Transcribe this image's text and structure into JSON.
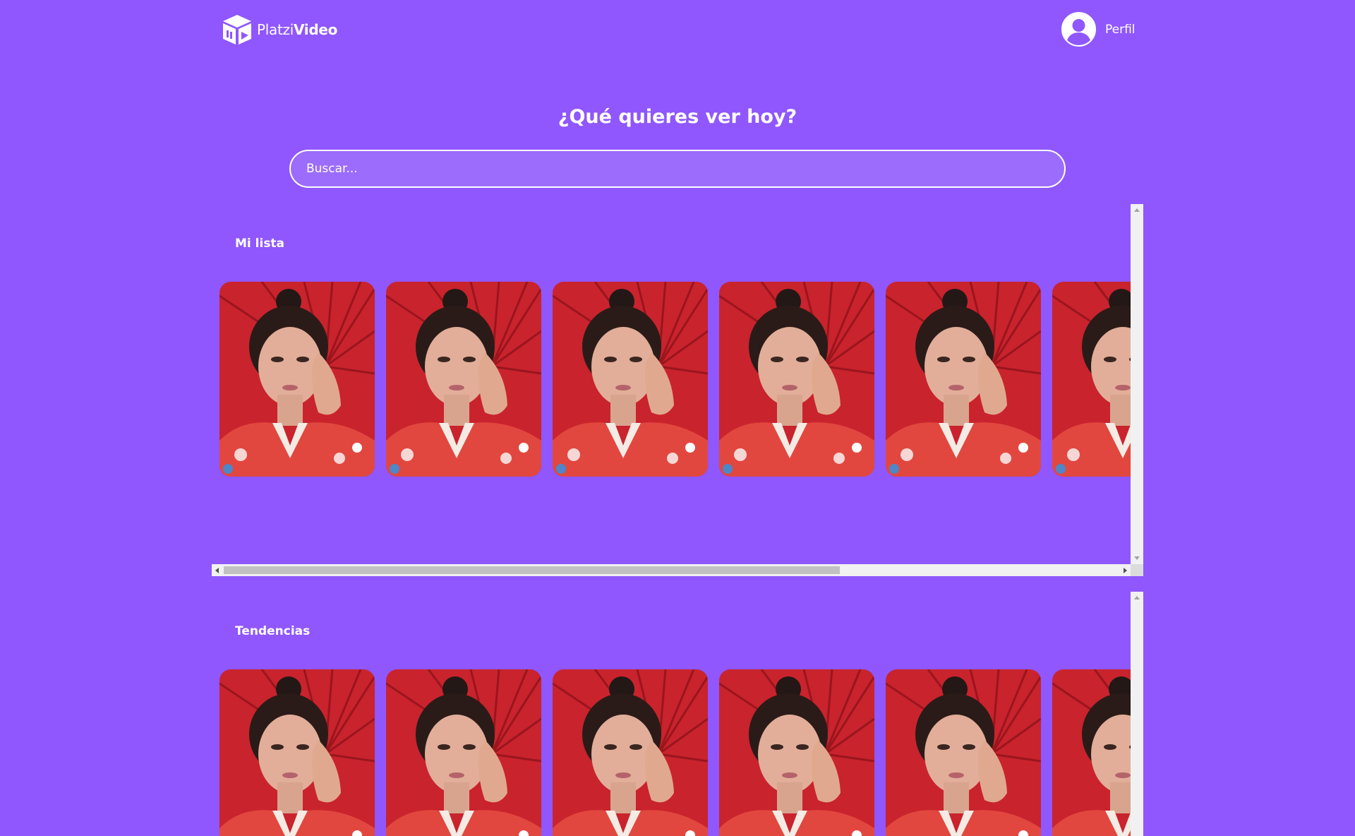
{
  "header": {
    "logo": {
      "name_regular": "Platzi",
      "name_bold": "Video",
      "icon": "cube-play-icon"
    },
    "profile": {
      "label": "Perfil",
      "icon": "user-avatar-icon"
    }
  },
  "search": {
    "title": "¿Qué quieres ver hoy?",
    "placeholder": "Buscar..."
  },
  "categories": [
    {
      "title": "Mi lista",
      "thumbnails": 6
    },
    {
      "title": "Tendencias",
      "thumbnails": 6
    }
  ],
  "colors": {
    "background": "#8f57fd",
    "search_fill": "#9c6cfd",
    "text": "#ffffff"
  }
}
